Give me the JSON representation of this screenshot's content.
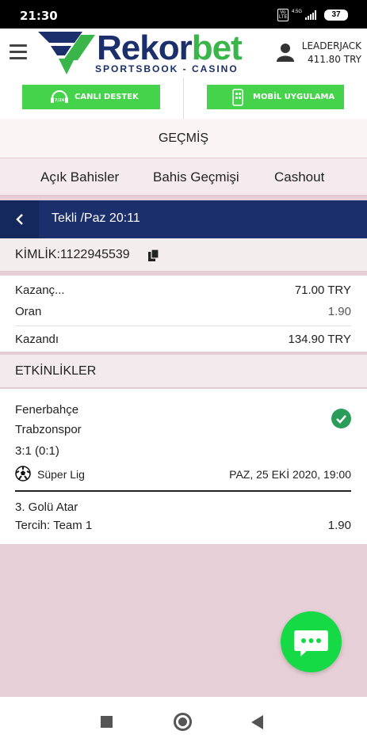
{
  "status_bar": {
    "time": "21:30",
    "network": "4.5G",
    "volte": "Vo LTE",
    "battery": "37"
  },
  "header": {
    "brand_part1": "Rekor",
    "brand_part2": "bet",
    "brand_tagline": "SPORTSBOOK - CASINO",
    "username": "LEADERJACK",
    "balance": "411.80 TRY"
  },
  "actions": {
    "support_label": "CANLI DESTEK",
    "support_badge": "7/24",
    "app_label": "MOBİL UYGULAMA"
  },
  "page_title": "GEÇMİŞ",
  "tabs": [
    "Açık Bahisler",
    "Bahis Geçmişi",
    "Cashout"
  ],
  "bet_header": {
    "title": "Tekli /Paz 20:11"
  },
  "bet_id": "KİMLİK:1122945539",
  "summary": {
    "stake_label": "Kazanç...",
    "stake_value": "71.00 TRY",
    "odds_label": "Oran",
    "odds_value": "1.90",
    "won_label": "Kazandı",
    "won_value": "134.90 TRY"
  },
  "events_heading": "ETKİNLİKLER",
  "event": {
    "home": "Fenerbahçe",
    "away": "Trabzonspor",
    "score": "3:1 (0:1)",
    "league": "Süper Lig",
    "datetime": "PAZ, 25 EKİ 2020, 19:00",
    "market": "3. Golü Atar",
    "selection": "Tercih: Team 1",
    "odds": "1.90"
  },
  "colors": {
    "brand_navy": "#1a2f6b",
    "brand_green": "#39b54a",
    "button_green": "#45d34b",
    "win_green": "#2a9d5a"
  }
}
